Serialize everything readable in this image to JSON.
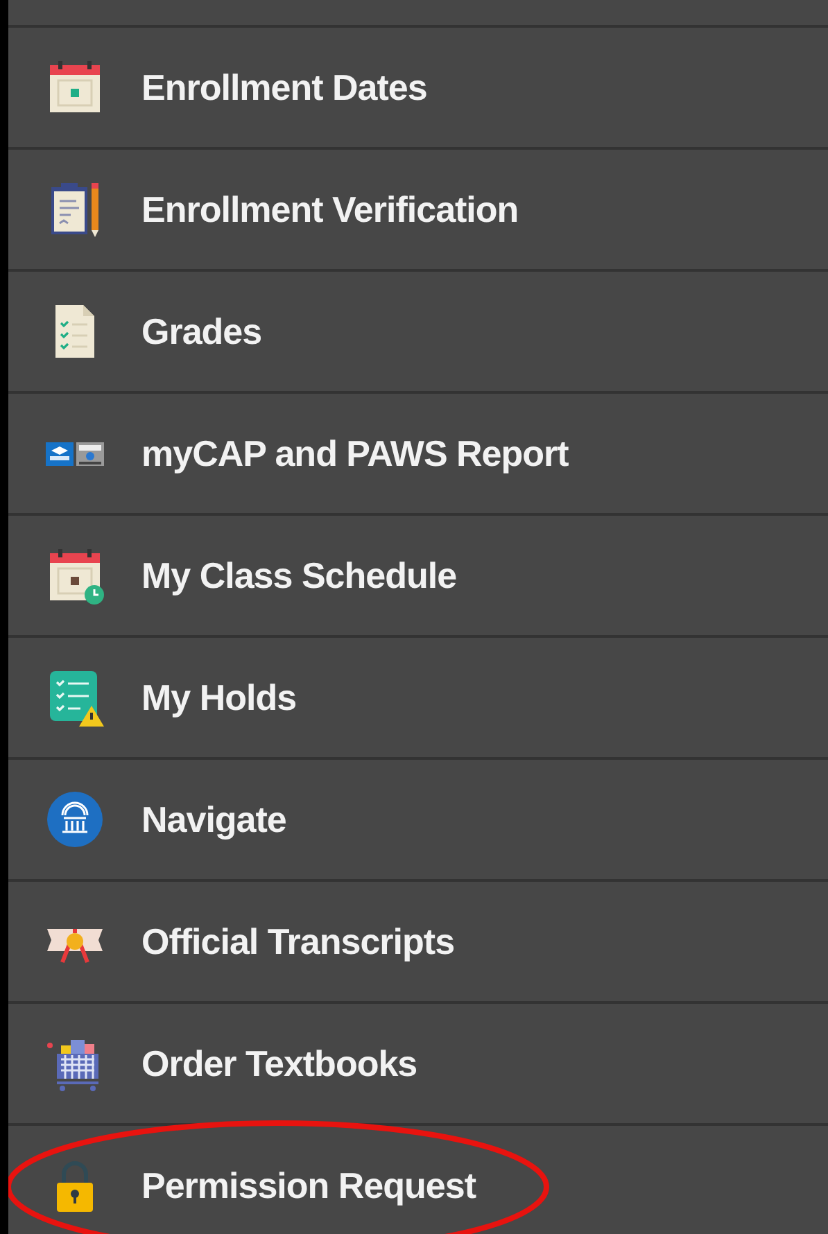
{
  "menu": {
    "items": [
      {
        "label": "Enrollment Dates",
        "kind": "calendar",
        "circled": false
      },
      {
        "label": "Enrollment Verification",
        "kind": "clipboard",
        "circled": false
      },
      {
        "label": "Grades",
        "kind": "document",
        "circled": false
      },
      {
        "label": "myCAP and PAWS Report",
        "kind": "report-logos",
        "circled": false
      },
      {
        "label": "My Class Schedule",
        "kind": "calendar-clock",
        "circled": false
      },
      {
        "label": "My Holds",
        "kind": "checklist-warning",
        "circled": false
      },
      {
        "label": "Navigate",
        "kind": "building-badge",
        "circled": false
      },
      {
        "label": "Official Transcripts",
        "kind": "diploma",
        "circled": false
      },
      {
        "label": "Order Textbooks",
        "kind": "cart",
        "circled": false
      },
      {
        "label": "Permission Request",
        "kind": "lock",
        "circled": true
      }
    ]
  }
}
